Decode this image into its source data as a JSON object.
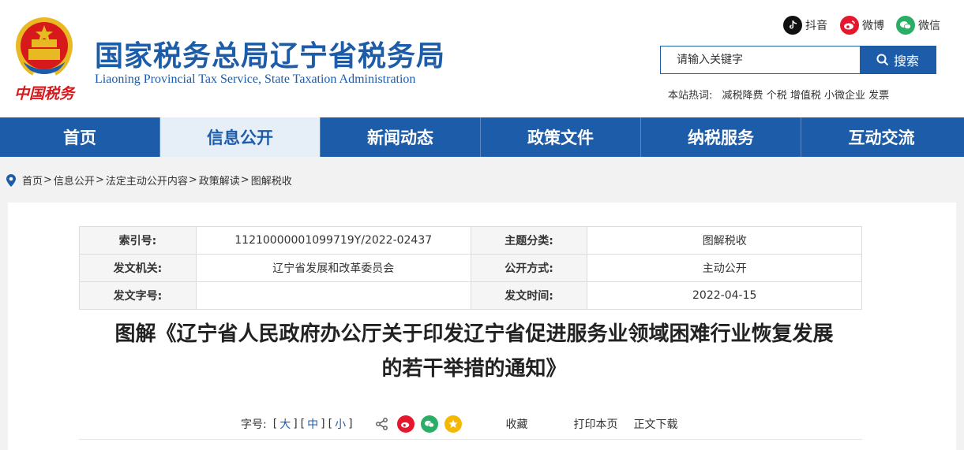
{
  "header": {
    "emblem_caption": "中国税务",
    "title": "国家税务总局辽宁省税务局",
    "subtitle": "Liaoning Provincial Tax Service, State Taxation Administration",
    "social": [
      {
        "label": "抖音",
        "icon": "douyin-icon",
        "color": "#111111"
      },
      {
        "label": "微博",
        "icon": "weibo-icon",
        "color": "#e6162d"
      },
      {
        "label": "微信",
        "icon": "wechat-icon",
        "color": "#2aae67"
      }
    ],
    "search": {
      "placeholder": "请输入关键字",
      "button_label": "搜索"
    },
    "hot": {
      "label": "本站热词:",
      "items": [
        "减税降费",
        "个税",
        "增值税",
        "小微企业",
        "发票"
      ]
    }
  },
  "nav": {
    "items": [
      {
        "label": "首页"
      },
      {
        "label": "信息公开",
        "active": true
      },
      {
        "label": "新闻动态"
      },
      {
        "label": "政策文件"
      },
      {
        "label": "纳税服务"
      },
      {
        "label": "互动交流"
      }
    ]
  },
  "breadcrumb": {
    "items": [
      "首页",
      "信息公开",
      "法定主动公开内容",
      "政策解读",
      "图解税收"
    ],
    "separator": ">"
  },
  "meta": {
    "rows": [
      {
        "label1": "索引号:",
        "value1": "11210000001099719Y/2022-02437",
        "label2": "主题分类:",
        "value2": "图解税收"
      },
      {
        "label1": "发文机关:",
        "value1": "辽宁省发展和改革委员会",
        "label2": "公开方式:",
        "value2": "主动公开"
      },
      {
        "label1": "发文字号:",
        "value1": "",
        "label2": "发文时间:",
        "value2": "2022-04-15"
      }
    ]
  },
  "article": {
    "title_line1": "图解《辽宁省人民政府办公厅关于印发辽宁省促进服务业领域困难行业恢复发展",
    "title_line2": "的若干举措的通知》"
  },
  "toolbar": {
    "font_label": "字号:",
    "sizes": [
      "大",
      "中",
      "小"
    ],
    "favorite": "收藏",
    "print": "打印本页",
    "download": "正文下载"
  },
  "colors": {
    "brand": "#1d5ca8",
    "emblem_red": "#d7191c",
    "emblem_gold": "#e8b923"
  }
}
